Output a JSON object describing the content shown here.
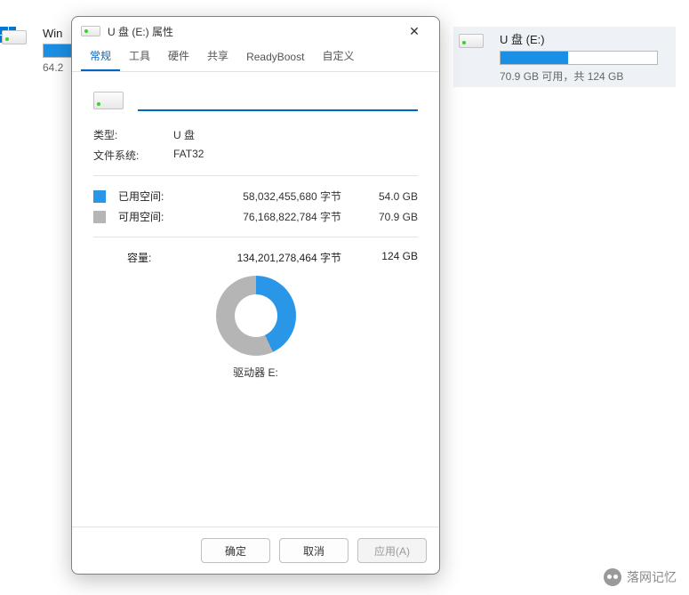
{
  "explorer": {
    "left_drive": {
      "name": "Win",
      "sub": "64.2"
    },
    "right_drive": {
      "name": "U 盘 (E:)",
      "fill_pct": 43,
      "usage_text": "70.9 GB 可用，共 124 GB"
    }
  },
  "dialog": {
    "title": "U 盘 (E:) 属性",
    "tabs": [
      "常规",
      "工具",
      "硬件",
      "共享",
      "ReadyBoost",
      "自定义"
    ],
    "active_tab": 0,
    "type_label": "类型:",
    "type_value": "U 盘",
    "fs_label": "文件系统:",
    "fs_value": "FAT32",
    "used_label": "已用空间:",
    "used_bytes": "58,032,455,680 字节",
    "used_hr": "54.0 GB",
    "free_label": "可用空间:",
    "free_bytes": "76,168,822,784 字节",
    "free_hr": "70.9 GB",
    "cap_label": "容量:",
    "cap_bytes": "134,201,278,464 字节",
    "cap_hr": "124 GB",
    "drive_footer": "驱动器 E:",
    "ok": "确定",
    "cancel": "取消",
    "apply": "应用(A)"
  },
  "watermark": "落网记忆",
  "chart_data": {
    "type": "pie",
    "title": "驱动器 E:",
    "series": [
      {
        "name": "已用空间",
        "value": 54.0,
        "unit": "GB",
        "color": "#2a96e8"
      },
      {
        "name": "可用空间",
        "value": 70.9,
        "unit": "GB",
        "color": "#b5b5b5"
      }
    ],
    "total": {
      "label": "容量",
      "value": 124,
      "unit": "GB"
    }
  }
}
